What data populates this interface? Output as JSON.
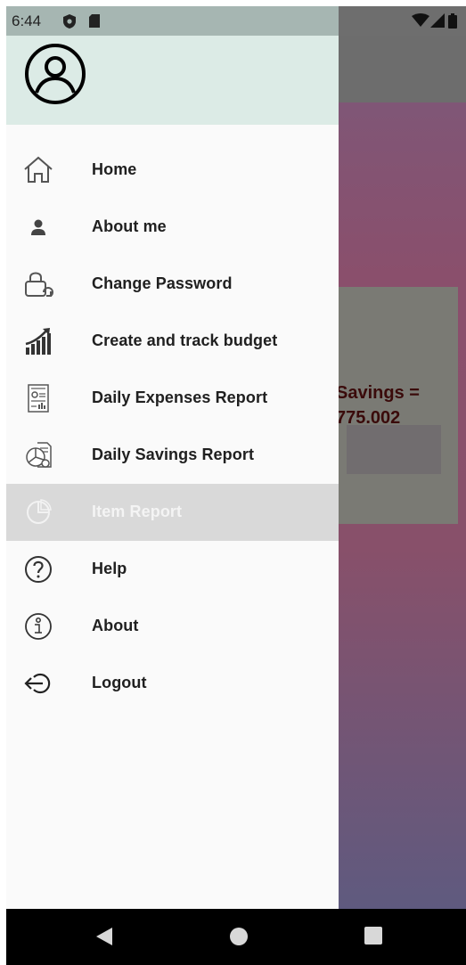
{
  "status_bar": {
    "time": "6:44",
    "icons_left": [
      "shield-icon",
      "sd-card-icon"
    ],
    "icons_right": [
      "wifi-icon",
      "signal-icon",
      "battery-icon"
    ]
  },
  "background_app": {
    "savings_label": "Savings =",
    "savings_value": "775.002"
  },
  "drawer": {
    "header_icon": "account-circle-icon",
    "items": [
      {
        "label": "Home",
        "icon": "home-icon",
        "selected": false
      },
      {
        "label": "About me",
        "icon": "person-icon",
        "selected": false
      },
      {
        "label": "Change Password",
        "icon": "lock-refresh-icon",
        "selected": false
      },
      {
        "label": "Create and track budget",
        "icon": "growth-chart-icon",
        "selected": false
      },
      {
        "label": "Daily Expenses Report",
        "icon": "report-document-icon",
        "selected": false
      },
      {
        "label": "Daily Savings Report",
        "icon": "pie-report-icon",
        "selected": false
      },
      {
        "label": "Item Report",
        "icon": "pie-chart-icon",
        "selected": true
      },
      {
        "label": "Help",
        "icon": "help-circle-icon",
        "selected": false
      },
      {
        "label": "About",
        "icon": "info-circle-icon",
        "selected": false
      },
      {
        "label": "Logout",
        "icon": "logout-icon",
        "selected": false
      }
    ]
  },
  "nav_bar": {
    "buttons": [
      "back-icon",
      "home-circle-icon",
      "recents-square-icon"
    ]
  },
  "colors": {
    "drawer_bg": "#fafafa",
    "header_bg": "#dcebe6",
    "selected_bg": "#d9d9d9",
    "text": "#202020"
  }
}
